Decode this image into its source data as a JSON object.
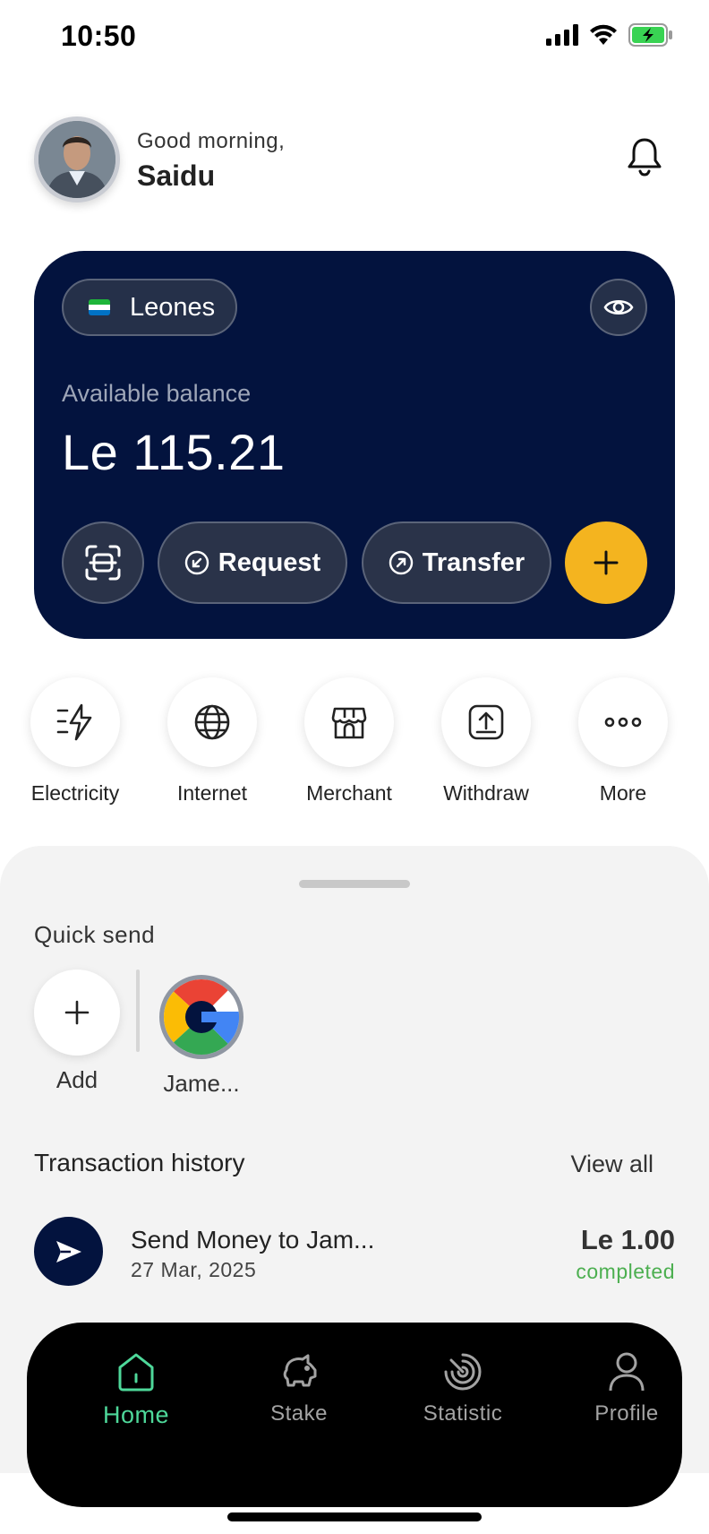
{
  "status_bar": {
    "time": "10:50"
  },
  "header": {
    "greeting": "Good morning,",
    "name": "Saidu"
  },
  "balance_card": {
    "currency": "Leones",
    "balance_label": "Available balance",
    "balance": "Le 115.21",
    "request_label": "Request",
    "transfer_label": "Transfer"
  },
  "services": [
    {
      "label": "Electricity",
      "icon": "electricity-icon"
    },
    {
      "label": "Internet",
      "icon": "globe-icon"
    },
    {
      "label": "Merchant",
      "icon": "store-icon"
    },
    {
      "label": "Withdraw",
      "icon": "withdraw-icon"
    },
    {
      "label": "More",
      "icon": "more-icon"
    }
  ],
  "quick_send": {
    "title": "Quick send",
    "add_label": "Add",
    "contacts": [
      {
        "name": "Jame..."
      }
    ]
  },
  "transactions": {
    "title": "Transaction history",
    "view_all": "View all",
    "items": [
      {
        "name": "Send Money to Jam...",
        "date": "27 Mar, 2025",
        "amount": "Le 1.00",
        "status": "completed"
      }
    ]
  },
  "tabbar": {
    "tabs": [
      {
        "label": "Home",
        "icon": "home-icon",
        "active": true
      },
      {
        "label": "Stake",
        "icon": "piggy-bank-icon",
        "active": false
      },
      {
        "label": "Statistic",
        "icon": "statistic-icon",
        "active": false
      },
      {
        "label": "Profile",
        "icon": "profile-icon",
        "active": false
      }
    ]
  },
  "colors": {
    "card": "#03133e",
    "accent_yellow": "#f4b41f",
    "active_tab": "#4ed89a",
    "completed": "#4caf50"
  }
}
